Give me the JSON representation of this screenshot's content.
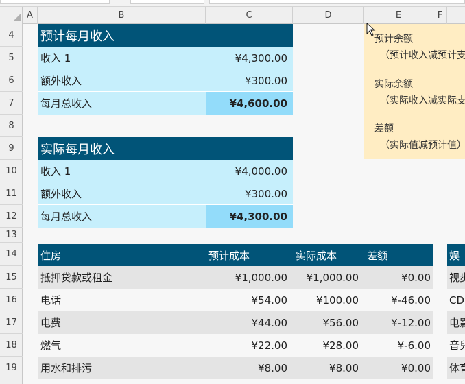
{
  "columns": [
    "A",
    "B",
    "C",
    "D",
    "E",
    "F"
  ],
  "rows": [
    "4",
    "5",
    "6",
    "7",
    "8",
    "9",
    "10",
    "11",
    "12",
    "13",
    "14",
    "15",
    "16",
    "17",
    "18",
    "19"
  ],
  "projected_income": {
    "title": "预计每月收入",
    "items": [
      {
        "label": "收入 1",
        "value": "¥4,300.00"
      },
      {
        "label": "额外收入",
        "value": "¥300.00"
      }
    ],
    "total_label": "每月总收入",
    "total_value": "¥4,600.00"
  },
  "actual_income": {
    "title": "实际每月收入",
    "items": [
      {
        "label": "收入 1",
        "value": "¥4,000.00"
      },
      {
        "label": "额外收入",
        "value": "¥300.00"
      }
    ],
    "total_label": "每月总收入",
    "total_value": "¥4,300.00"
  },
  "notes": [
    {
      "title": "预计余额",
      "detail": "（预计收入减预计支"
    },
    {
      "title": "实际余额",
      "detail": "（实际收入减实际支"
    },
    {
      "title": "差额",
      "detail": "（实际值减预计值）"
    }
  ],
  "housing": {
    "headers": [
      "住房",
      "预计成本",
      "实际成本",
      "差额"
    ],
    "rows": [
      [
        "抵押贷款或租金",
        "¥1,000.00",
        "¥1,000.00",
        "¥0.00"
      ],
      [
        "电话",
        "¥54.00",
        "¥100.00",
        "¥-46.00"
      ],
      [
        "电费",
        "¥44.00",
        "¥56.00",
        "¥-12.00"
      ],
      [
        "燃气",
        "¥22.00",
        "¥28.00",
        "¥-6.00"
      ],
      [
        "用水和排污",
        "¥8.00",
        "¥8.00",
        "¥0.00"
      ]
    ]
  },
  "entertainment": {
    "header": "娱",
    "rows": [
      "视步",
      "CD",
      "电影",
      "音兒",
      "体育"
    ]
  }
}
